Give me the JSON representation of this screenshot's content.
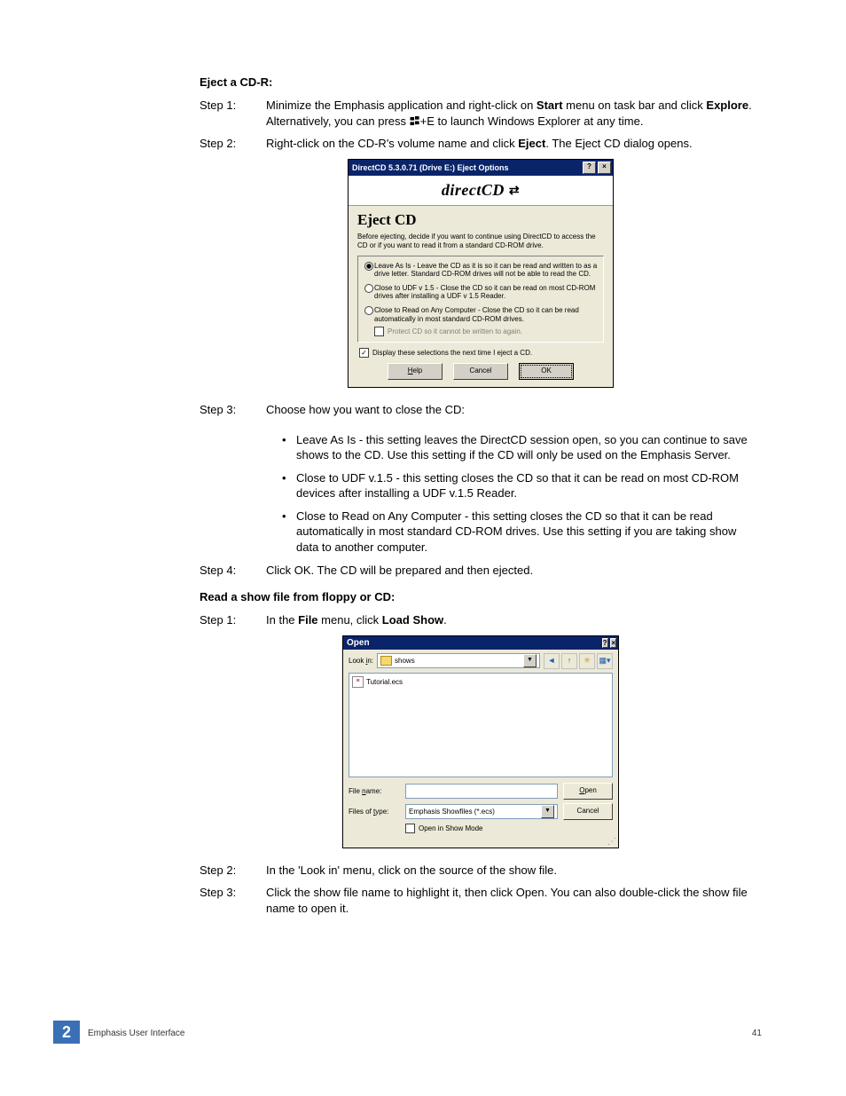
{
  "section1_heading": "Eject a CD-R:",
  "steps_a": {
    "s1_label": "Step 1:",
    "s1_a": "Minimize the Emphasis application and right-click on ",
    "s1_b": "Start",
    "s1_c": " menu on task bar and click ",
    "s1_d": "Explore",
    "s1_e": ". Alternatively, you can press ",
    "s1_f": "+E to launch Windows Explorer at any time.",
    "s2_label": "Step 2:",
    "s2_a": "Right-click on the CD-R's volume name and click ",
    "s2_b": "Eject",
    "s2_c": ". The Eject CD dialog opens.",
    "s3_label": "Step 3:",
    "s3_text": "Choose how you want to close the CD:",
    "s4_label": "Step 4:",
    "s4_text": "Click OK. The CD will be prepared and then ejected."
  },
  "bullets": {
    "b1": "Leave As Is - this setting leaves the DirectCD session open, so you can continue to save shows to the CD. Use this setting if the CD will only be used on the Emphasis Server.",
    "b2": "Close to UDF v.1.5 - this setting closes the CD so that it can be read on most CD-ROM devices after installing a UDF v.1.5 Reader.",
    "b3": "Close to Read on Any Computer - this setting closes the CD so that it can be read automatically in most standard CD-ROM drives. Use this setting if you are taking show data to another computer."
  },
  "dlg1": {
    "title": "DirectCD 5.3.0.71 (Drive E:) Eject Options",
    "banner": "directCD",
    "heading": "Eject CD",
    "intro": "Before ejecting, decide if you want to continue using DirectCD to access the CD or if you want to read it from a standard CD-ROM drive.",
    "opt1": "Leave As Is - Leave the CD as it is so it can be read and written to as a drive letter. Standard CD-ROM drives will not be able to read the CD.",
    "opt2": "Close to UDF v 1.5 - Close the CD so it can be read on most CD-ROM drives after installing a UDF v 1.5 Reader.",
    "opt3": "Close to Read on Any Computer - Close the CD so it can be read automatically in most standard CD-ROM drives.",
    "protect": "Protect CD so it cannot be written to again.",
    "display": "Display these selections the next time I eject a CD.",
    "help": "Help",
    "cancel": "Cancel",
    "ok": "OK"
  },
  "section2_heading": "Read a show file from floppy or CD:",
  "steps_b": {
    "s1_label": "Step 1:",
    "s1_a": "In the ",
    "s1_b": "File",
    "s1_c": " menu, click ",
    "s1_d": "Load Show",
    "s1_e": ".",
    "s2_label": "Step 2:",
    "s2_text": "In the 'Look in' menu, click on the source of the show file.",
    "s3_label": "Step 3:",
    "s3_text": "Click the show file name to highlight it, then click Open. You can also double-click the show file name to open it."
  },
  "dlg2": {
    "title": "Open",
    "lookin_label": "Look in:",
    "lookin_value": "shows",
    "file_item": "Tutorial.ecs",
    "filename_label": "File name:",
    "filename_value": "",
    "filetype_label": "Files of type:",
    "filetype_value": "Emphasis Showfiles (*.ecs)",
    "open_btn": "Open",
    "cancel_btn": "Cancel",
    "checkbox": "Open in Show Mode"
  },
  "footer": {
    "chapter_num": "2",
    "footer_left": "Emphasis User Interface",
    "page_num": "41"
  }
}
